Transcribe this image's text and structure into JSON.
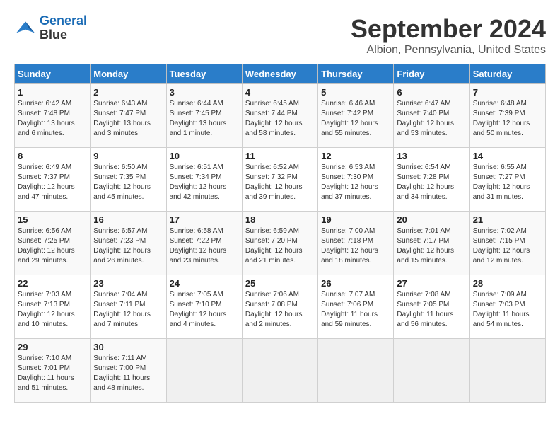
{
  "header": {
    "logo_line1": "General",
    "logo_line2": "Blue",
    "month": "September 2024",
    "location": "Albion, Pennsylvania, United States"
  },
  "weekdays": [
    "Sunday",
    "Monday",
    "Tuesday",
    "Wednesday",
    "Thursday",
    "Friday",
    "Saturday"
  ],
  "weeks": [
    [
      {
        "day": "1",
        "sunrise": "6:42 AM",
        "sunset": "7:48 PM",
        "daylight": "13 hours and 6 minutes."
      },
      {
        "day": "2",
        "sunrise": "6:43 AM",
        "sunset": "7:47 PM",
        "daylight": "13 hours and 3 minutes."
      },
      {
        "day": "3",
        "sunrise": "6:44 AM",
        "sunset": "7:45 PM",
        "daylight": "13 hours and 1 minute."
      },
      {
        "day": "4",
        "sunrise": "6:45 AM",
        "sunset": "7:44 PM",
        "daylight": "12 hours and 58 minutes."
      },
      {
        "day": "5",
        "sunrise": "6:46 AM",
        "sunset": "7:42 PM",
        "daylight": "12 hours and 55 minutes."
      },
      {
        "day": "6",
        "sunrise": "6:47 AM",
        "sunset": "7:40 PM",
        "daylight": "12 hours and 53 minutes."
      },
      {
        "day": "7",
        "sunrise": "6:48 AM",
        "sunset": "7:39 PM",
        "daylight": "12 hours and 50 minutes."
      }
    ],
    [
      {
        "day": "8",
        "sunrise": "6:49 AM",
        "sunset": "7:37 PM",
        "daylight": "12 hours and 47 minutes."
      },
      {
        "day": "9",
        "sunrise": "6:50 AM",
        "sunset": "7:35 PM",
        "daylight": "12 hours and 45 minutes."
      },
      {
        "day": "10",
        "sunrise": "6:51 AM",
        "sunset": "7:34 PM",
        "daylight": "12 hours and 42 minutes."
      },
      {
        "day": "11",
        "sunrise": "6:52 AM",
        "sunset": "7:32 PM",
        "daylight": "12 hours and 39 minutes."
      },
      {
        "day": "12",
        "sunrise": "6:53 AM",
        "sunset": "7:30 PM",
        "daylight": "12 hours and 37 minutes."
      },
      {
        "day": "13",
        "sunrise": "6:54 AM",
        "sunset": "7:28 PM",
        "daylight": "12 hours and 34 minutes."
      },
      {
        "day": "14",
        "sunrise": "6:55 AM",
        "sunset": "7:27 PM",
        "daylight": "12 hours and 31 minutes."
      }
    ],
    [
      {
        "day": "15",
        "sunrise": "6:56 AM",
        "sunset": "7:25 PM",
        "daylight": "12 hours and 29 minutes."
      },
      {
        "day": "16",
        "sunrise": "6:57 AM",
        "sunset": "7:23 PM",
        "daylight": "12 hours and 26 minutes."
      },
      {
        "day": "17",
        "sunrise": "6:58 AM",
        "sunset": "7:22 PM",
        "daylight": "12 hours and 23 minutes."
      },
      {
        "day": "18",
        "sunrise": "6:59 AM",
        "sunset": "7:20 PM",
        "daylight": "12 hours and 21 minutes."
      },
      {
        "day": "19",
        "sunrise": "7:00 AM",
        "sunset": "7:18 PM",
        "daylight": "12 hours and 18 minutes."
      },
      {
        "day": "20",
        "sunrise": "7:01 AM",
        "sunset": "7:17 PM",
        "daylight": "12 hours and 15 minutes."
      },
      {
        "day": "21",
        "sunrise": "7:02 AM",
        "sunset": "7:15 PM",
        "daylight": "12 hours and 12 minutes."
      }
    ],
    [
      {
        "day": "22",
        "sunrise": "7:03 AM",
        "sunset": "7:13 PM",
        "daylight": "12 hours and 10 minutes."
      },
      {
        "day": "23",
        "sunrise": "7:04 AM",
        "sunset": "7:11 PM",
        "daylight": "12 hours and 7 minutes."
      },
      {
        "day": "24",
        "sunrise": "7:05 AM",
        "sunset": "7:10 PM",
        "daylight": "12 hours and 4 minutes."
      },
      {
        "day": "25",
        "sunrise": "7:06 AM",
        "sunset": "7:08 PM",
        "daylight": "12 hours and 2 minutes."
      },
      {
        "day": "26",
        "sunrise": "7:07 AM",
        "sunset": "7:06 PM",
        "daylight": "11 hours and 59 minutes."
      },
      {
        "day": "27",
        "sunrise": "7:08 AM",
        "sunset": "7:05 PM",
        "daylight": "11 hours and 56 minutes."
      },
      {
        "day": "28",
        "sunrise": "7:09 AM",
        "sunset": "7:03 PM",
        "daylight": "11 hours and 54 minutes."
      }
    ],
    [
      {
        "day": "29",
        "sunrise": "7:10 AM",
        "sunset": "7:01 PM",
        "daylight": "11 hours and 51 minutes."
      },
      {
        "day": "30",
        "sunrise": "7:11 AM",
        "sunset": "7:00 PM",
        "daylight": "11 hours and 48 minutes."
      },
      null,
      null,
      null,
      null,
      null
    ]
  ]
}
